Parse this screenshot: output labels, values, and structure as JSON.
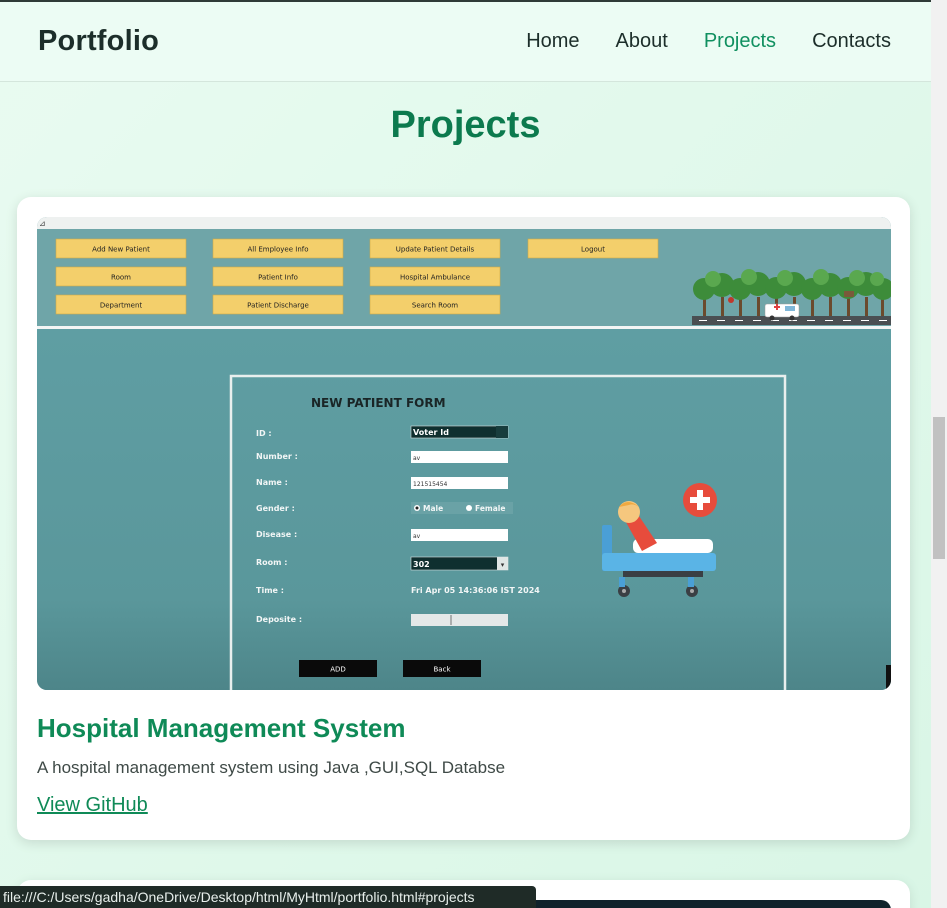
{
  "nav": {
    "brand": "Portfolio",
    "links": [
      {
        "label": "Home",
        "active": false
      },
      {
        "label": "About",
        "active": false
      },
      {
        "label": "Projects",
        "active": true
      },
      {
        "label": "Contacts",
        "active": false
      }
    ]
  },
  "projects": {
    "title": "Projects",
    "items": [
      {
        "title": "Hospital Management System",
        "description": "A hospital management system using Java ,GUI,SQL Databse",
        "link_label": "View GitHub",
        "screenshot": {
          "menu_buttons": [
            "Add New Patient",
            "All Employee Info",
            "Update Patient Details",
            "Logout",
            "Room",
            "Patient Info",
            "Hospital Ambulance",
            "Department",
            "Patient Discharge",
            "Search Room"
          ],
          "form_title": "NEW PATIENT FORM",
          "field_labels": [
            "ID :",
            "Number :",
            "Name :",
            "Gender :",
            "Disease :",
            "Room :",
            "Time :",
            "Deposite :"
          ],
          "id_value": "Voter Id",
          "number_value": "av",
          "name_value": "121515454",
          "gender_male": "Male",
          "gender_female": "Female",
          "disease_value": "av",
          "room_value": "302",
          "time_value": "Fri Apr 05 14:36:06 IST 2024",
          "add_label": "ADD",
          "back_label": "Back"
        }
      }
    ]
  },
  "status_bar": {
    "url": "file:///C:/Users/gadha/OneDrive/Desktop/html/MyHtml/portfolio.html#projects"
  },
  "colors": {
    "accent": "#109060",
    "title": "#0c7a4e",
    "screenshot_teal": "#5b9ba0",
    "menu_button_yellow": "#f3cf6b"
  }
}
